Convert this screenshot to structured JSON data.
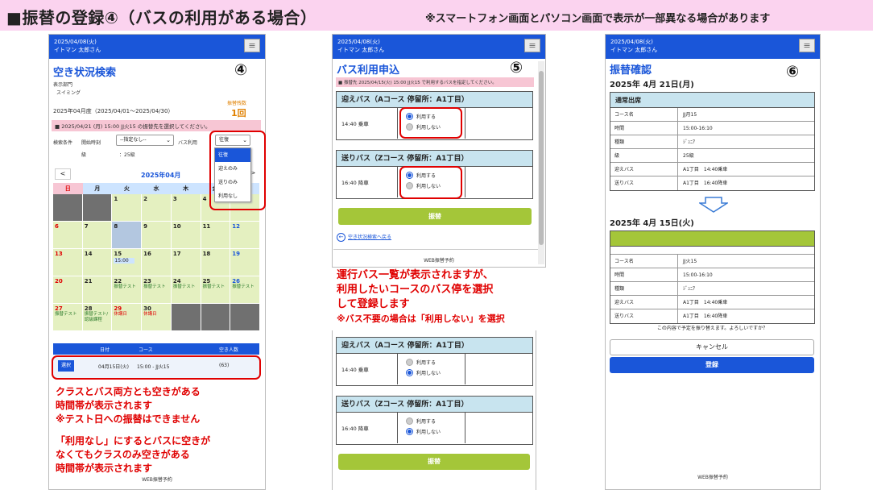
{
  "header": {
    "title": "■振替の登録④（バスの利用がある場合）",
    "note": "※スマートフォン画面とパソコン画面で表示が一部異なる場合があります"
  },
  "phone_top": {
    "date": "2025/04/08(火)",
    "user": "イトマン 太郎さん",
    "menu_icon": "≡"
  },
  "screen4": {
    "title": "空き状況検索",
    "step": "④",
    "dept_label": "表示部門",
    "dept_value": "スイミング",
    "period": "2025年04月度（2025/04/01～2025/04/30）",
    "transfer_count_label": "振替残数",
    "transfer_count": "1回",
    "pink_message": "■ 2025/04/21 (月) 15:00 JJ火15 の振替先を選択してください。",
    "search_label": "検索条件",
    "start_time_label": "開始時刻",
    "start_time_value": "--指定なし--",
    "bus_label": "バス利用",
    "bus_value": "往復",
    "grade_label": "級",
    "grade_value": "：25級",
    "dropdown_options": [
      "往復",
      "迎えのみ",
      "送りのみ",
      "利用なし"
    ],
    "prev": "<",
    "next": ">",
    "month": "2025年04月",
    "weekdays": [
      "日",
      "月",
      "火",
      "水",
      "木",
      "金",
      "土"
    ],
    "weekday_colors": [
      "#f7c6d4",
      "#cde4ff",
      "#cde4ff",
      "#cde4ff",
      "#cde4ff",
      "#cde4ff",
      "#cde4ff"
    ],
    "days": [
      "",
      "",
      "1",
      "2",
      "3",
      "4",
      "5",
      "6",
      "7",
      "8",
      "9",
      "10",
      "11",
      "12",
      "13",
      "14",
      "15",
      "16",
      "17",
      "18",
      "19",
      "20",
      "21",
      "22",
      "23",
      "24",
      "25",
      "26",
      "27",
      "28",
      "29",
      "30",
      "",
      "",
      ""
    ],
    "cell_events": {
      "15": "15:00",
      "22": "振替テスト",
      "23": "振替テスト",
      "24": "振替テスト",
      "25": "振替テスト",
      "26": "振替テスト",
      "27": "振替テスト",
      "28": "振替テスト/\n認級課程",
      "29": "休講日",
      "30": "休講日"
    },
    "result_header": [
      "日付",
      "コース",
      "空き人数"
    ],
    "select_button": "選択",
    "result_date": "04月15日(火)",
    "result_course": "15:00 - JJ火15",
    "result_seats": "(63)"
  },
  "annotation_left": [
    "クラスとバス両方とも空きがある",
    "時間帯が表示されます",
    "※テスト日への振替はできません",
    "",
    "「利用なし」にするとバスに空きが",
    "なくてもクラスのみ空きがある",
    "時間帯が表示されます"
  ],
  "footer": "WEB振替予約",
  "screen5": {
    "title": "バス利用申込",
    "step": "⑤",
    "pink_message": "■ 振替先 2025/04/15(火) 15:00 JJ火15 で利用するバスを指定してください。",
    "pickup_header": "迎えバス（Aコース 停留所：A1丁目）",
    "pickup_time": "14:40 乗車",
    "dropoff_header": "送りバス（Zコース 停留所：A1丁目）",
    "dropoff_time": "16:40 降車",
    "use": "利用する",
    "not_use": "利用しない",
    "submit": "振替",
    "back_link": "空き状況検索へ戻る"
  },
  "annotation_mid": [
    "運行バス一覧が表示されますが、",
    "利用したいコースのバス停を選択",
    "して登録します",
    "※バス不要の場合は「利用しない」を選択"
  ],
  "screen6": {
    "title": "振替確認",
    "step": "⑥",
    "date_from": "2025年 4月 21日(月)",
    "from_header": "通常出席",
    "date_to": "2025年 4月 15日(火)",
    "rows_from": [
      [
        "コース名",
        "JJ月15"
      ],
      [
        "時間",
        "15:00-16:10"
      ],
      [
        "種類",
        "ｼﾞｭﾆｱ"
      ],
      [
        "級",
        "25級"
      ],
      [
        "迎えバス",
        "A1丁目　14:40乗車"
      ],
      [
        "送りバス",
        "A1丁目　16:40降車"
      ]
    ],
    "rows_to": [
      [
        "コース名",
        "JJ火15"
      ],
      [
        "時間",
        "15:00-16:10"
      ],
      [
        "種類",
        "ｼﾞｭﾆｱ"
      ],
      [
        "迎えバス",
        "A1丁目　14:40乗車"
      ],
      [
        "送りバス",
        "A1丁目　16:40降車"
      ]
    ],
    "confirm_question": "この内容で予定を振り替えます。よろしいですか？",
    "cancel": "キャンセル",
    "register": "登録"
  }
}
